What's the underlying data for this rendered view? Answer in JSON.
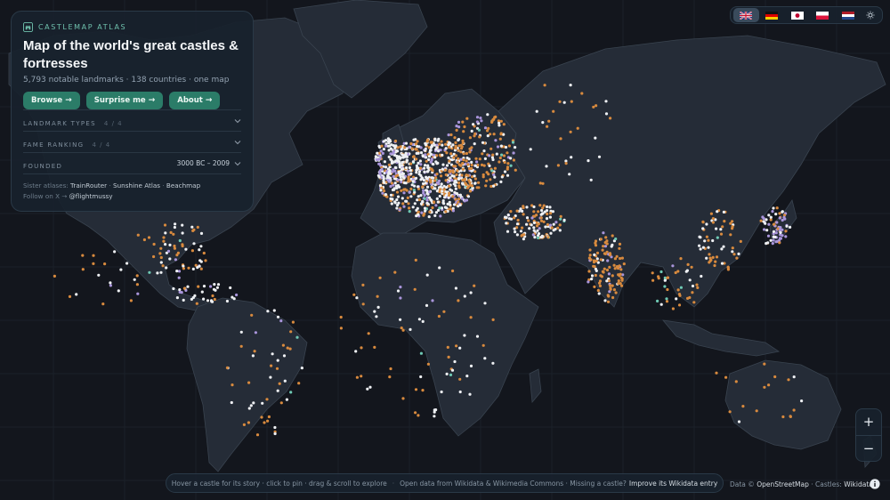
{
  "panel": {
    "brand": "CASTLEMAP ATLAS",
    "title": "Map of the world's great castles & fortresses",
    "subtitle": "5,793 notable landmarks · 138 countries · one map",
    "buttons": [
      {
        "label": "Browse",
        "icon": "arrow-right-icon"
      },
      {
        "label": "Surprise me",
        "icon": "arrow-right-icon"
      },
      {
        "label": "About",
        "icon": "arrow-right-icon"
      }
    ],
    "filters": [
      {
        "label": "LANDMARK TYPES",
        "count": "4 / 4",
        "value": ""
      },
      {
        "label": "FAME RANKING",
        "count": "4 / 4",
        "value": ""
      },
      {
        "label": "FOUNDED",
        "count": "",
        "value": "3000 BC – 2009"
      }
    ],
    "sister_prefix": "Sister atlases:",
    "sister_links": [
      "TrainRouter",
      "Sunshine Atlas",
      "Beachmap"
    ],
    "follow_prefix": "Follow on X →",
    "follow_handle": "@flightmussy"
  },
  "languages": [
    {
      "code": "en",
      "icon": "uk-flag-icon",
      "active": true
    },
    {
      "code": "de",
      "icon": "german-flag-icon",
      "active": false
    },
    {
      "code": "ja",
      "icon": "japanese-flag-icon",
      "active": false
    },
    {
      "code": "pl",
      "icon": "polish-flag-icon",
      "active": false
    },
    {
      "code": "nl",
      "icon": "dutch-flag-icon",
      "active": false
    }
  ],
  "theme_icon": "sun-icon",
  "zoom": {
    "in_label": "+",
    "out_label": "−"
  },
  "hint": {
    "part1": "Hover a castle for its story · click to pin · drag & scroll to explore",
    "part2": "Open data from Wikidata & Wikimedia Commons · Missing a castle?",
    "link": "Improve its Wikidata entry"
  },
  "attribution": {
    "prefix": "Data ©",
    "osm": "OpenStreetMap",
    "sep": "· Castles:",
    "source": "Wikidata"
  },
  "info_icon": "info-icon",
  "colors": {
    "background": "#13161d",
    "land": "#252c37",
    "accent": "#2b7c68",
    "marker_white": "#eef0f3",
    "marker_orange": "#d88a3e",
    "marker_purple": "#a995db",
    "marker_teal": "#6ec9b4"
  }
}
